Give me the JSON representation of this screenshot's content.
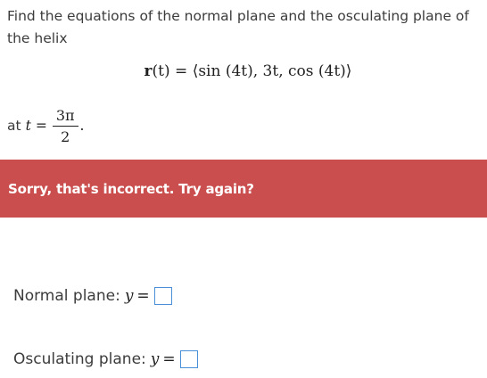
{
  "question": {
    "prompt": "Find the equations of the normal plane and the osculating plane of the helix",
    "formula": {
      "vector": "r",
      "arg": "(t)",
      "equals": "=",
      "expression": "⟨sin (4t), 3t, cos (4t)⟩"
    },
    "at": {
      "label": "at",
      "variable": "t",
      "equals": "=",
      "numerator": "3π",
      "denominator": "2",
      "period": "."
    }
  },
  "feedback": {
    "message": "Sorry, that's incorrect. Try again?",
    "color": "#cb4e4e"
  },
  "answers": {
    "normal": {
      "label": "Normal plane:",
      "variable": "y",
      "equals": "=",
      "value": ""
    },
    "osculating": {
      "label": "Osculating plane:",
      "variable": "y",
      "equals": "=",
      "value": ""
    }
  }
}
